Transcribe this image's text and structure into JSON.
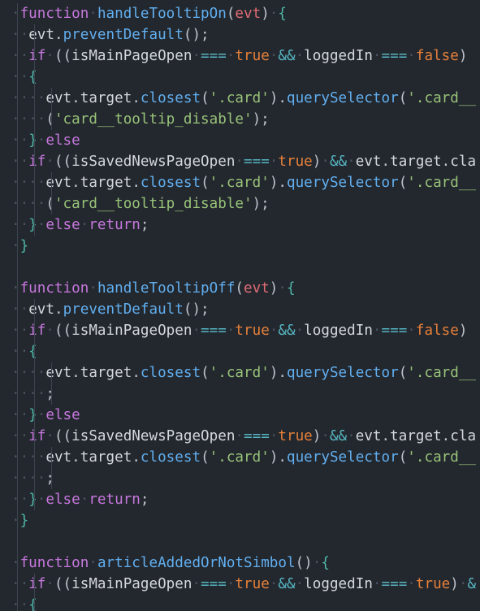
{
  "colors": {
    "background": "#23272e",
    "keyword": "#c678dd",
    "function_name": "#61afef",
    "identifier": "#d4d8dd",
    "operator": "#56b6c2",
    "boolean": "#e5803a",
    "string": "#98c379",
    "parameter": "#e06c75"
  },
  "lines": [
    [
      [
        "ws",
        "·"
      ],
      [
        "kw",
        "function"
      ],
      [
        "ws",
        "·"
      ],
      [
        "fn",
        "handleTooltipOn"
      ],
      [
        "pu",
        "("
      ],
      [
        "par",
        "evt"
      ],
      [
        "pu",
        ")"
      ],
      [
        "ws",
        "·"
      ],
      [
        "br",
        "{"
      ]
    ],
    [
      [
        "ws",
        "··"
      ],
      [
        "pl",
        "evt"
      ],
      [
        "pu",
        "."
      ],
      [
        "fn",
        "preventDefault"
      ],
      [
        "pu",
        "();"
      ]
    ],
    [
      [
        "ws",
        "··"
      ],
      [
        "kw",
        "if"
      ],
      [
        "ws",
        "·"
      ],
      [
        "pu",
        "(("
      ],
      [
        "pl",
        "isMainPageOpen"
      ],
      [
        "ws",
        "·"
      ],
      [
        "op",
        "==="
      ],
      [
        "ws",
        "·"
      ],
      [
        "bo",
        "true"
      ],
      [
        "ws",
        "·"
      ],
      [
        "op",
        "&&"
      ],
      [
        "ws",
        "·"
      ],
      [
        "pl",
        "loggedIn"
      ],
      [
        "ws",
        "·"
      ],
      [
        "op",
        "==="
      ],
      [
        "ws",
        "·"
      ],
      [
        "bo",
        "false"
      ],
      [
        "pu",
        ")"
      ]
    ],
    [
      [
        "ws",
        "··"
      ],
      [
        "br",
        "{"
      ]
    ],
    [
      [
        "ws",
        "····"
      ],
      [
        "pl",
        "evt"
      ],
      [
        "pu",
        "."
      ],
      [
        "pl",
        "target"
      ],
      [
        "pu",
        "."
      ],
      [
        "fn",
        "closest"
      ],
      [
        "pu",
        "("
      ],
      [
        "str",
        "'.card'"
      ],
      [
        "pu",
        ")."
      ],
      [
        "fn",
        "querySelector"
      ],
      [
        "pu",
        "("
      ],
      [
        "str",
        "'.card__"
      ]
    ],
    [
      [
        "ws",
        "····"
      ],
      [
        "pu",
        "("
      ],
      [
        "str",
        "'card__tooltip_disable'"
      ],
      [
        "pu",
        ");"
      ]
    ],
    [
      [
        "ws",
        "··"
      ],
      [
        "br",
        "}"
      ],
      [
        "ws",
        "·"
      ],
      [
        "kw",
        "else"
      ]
    ],
    [
      [
        "ws",
        "··"
      ],
      [
        "kw",
        "if"
      ],
      [
        "ws",
        "·"
      ],
      [
        "pu",
        "(("
      ],
      [
        "pl",
        "isSavedNewsPageOpen"
      ],
      [
        "ws",
        "·"
      ],
      [
        "op",
        "==="
      ],
      [
        "ws",
        "·"
      ],
      [
        "bo",
        "true"
      ],
      [
        "pu",
        ")"
      ],
      [
        "ws",
        "·"
      ],
      [
        "op",
        "&&"
      ],
      [
        "ws",
        "·"
      ],
      [
        "pl",
        "evt"
      ],
      [
        "pu",
        "."
      ],
      [
        "pl",
        "target"
      ],
      [
        "pu",
        "."
      ],
      [
        "pl",
        "cla"
      ]
    ],
    [
      [
        "ws",
        "····"
      ],
      [
        "pl",
        "evt"
      ],
      [
        "pu",
        "."
      ],
      [
        "pl",
        "target"
      ],
      [
        "pu",
        "."
      ],
      [
        "fn",
        "closest"
      ],
      [
        "pu",
        "("
      ],
      [
        "str",
        "'.card'"
      ],
      [
        "pu",
        ")."
      ],
      [
        "fn",
        "querySelector"
      ],
      [
        "pu",
        "("
      ],
      [
        "str",
        "'.card__"
      ]
    ],
    [
      [
        "ws",
        "····"
      ],
      [
        "pu",
        "("
      ],
      [
        "str",
        "'card__tooltip_disable'"
      ],
      [
        "pu",
        ");"
      ]
    ],
    [
      [
        "ws",
        "··"
      ],
      [
        "br",
        "}"
      ],
      [
        "ws",
        "·"
      ],
      [
        "kw",
        "else"
      ],
      [
        "ws",
        "·"
      ],
      [
        "kw",
        "return"
      ],
      [
        "pu",
        ";"
      ]
    ],
    [
      [
        "ws",
        "·"
      ],
      [
        "br",
        "}"
      ]
    ],
    [],
    [
      [
        "ws",
        "·"
      ],
      [
        "kw",
        "function"
      ],
      [
        "ws",
        "·"
      ],
      [
        "fn",
        "handleTooltipOff"
      ],
      [
        "pu",
        "("
      ],
      [
        "par",
        "evt"
      ],
      [
        "pu",
        ")"
      ],
      [
        "ws",
        "·"
      ],
      [
        "br",
        "{"
      ]
    ],
    [
      [
        "ws",
        "··"
      ],
      [
        "pl",
        "evt"
      ],
      [
        "pu",
        "."
      ],
      [
        "fn",
        "preventDefault"
      ],
      [
        "pu",
        "();"
      ]
    ],
    [
      [
        "ws",
        "··"
      ],
      [
        "kw",
        "if"
      ],
      [
        "ws",
        "·"
      ],
      [
        "pu",
        "(("
      ],
      [
        "pl",
        "isMainPageOpen"
      ],
      [
        "ws",
        "·"
      ],
      [
        "op",
        "==="
      ],
      [
        "ws",
        "·"
      ],
      [
        "bo",
        "true"
      ],
      [
        "ws",
        "·"
      ],
      [
        "op",
        "&&"
      ],
      [
        "ws",
        "·"
      ],
      [
        "pl",
        "loggedIn"
      ],
      [
        "ws",
        "·"
      ],
      [
        "op",
        "==="
      ],
      [
        "ws",
        "·"
      ],
      [
        "bo",
        "false"
      ],
      [
        "pu",
        ")"
      ]
    ],
    [
      [
        "ws",
        "··"
      ],
      [
        "br",
        "{"
      ]
    ],
    [
      [
        "ws",
        "····"
      ],
      [
        "pl",
        "evt"
      ],
      [
        "pu",
        "."
      ],
      [
        "pl",
        "target"
      ],
      [
        "pu",
        "."
      ],
      [
        "fn",
        "closest"
      ],
      [
        "pu",
        "("
      ],
      [
        "str",
        "'.card'"
      ],
      [
        "pu",
        ")."
      ],
      [
        "fn",
        "querySelector"
      ],
      [
        "pu",
        "("
      ],
      [
        "str",
        "'.card__"
      ]
    ],
    [
      [
        "ws",
        "····"
      ],
      [
        "pu",
        ";"
      ]
    ],
    [
      [
        "ws",
        "··"
      ],
      [
        "br",
        "}"
      ],
      [
        "ws",
        "·"
      ],
      [
        "kw",
        "else"
      ]
    ],
    [
      [
        "ws",
        "··"
      ],
      [
        "kw",
        "if"
      ],
      [
        "ws",
        "·"
      ],
      [
        "pu",
        "(("
      ],
      [
        "pl",
        "isSavedNewsPageOpen"
      ],
      [
        "ws",
        "·"
      ],
      [
        "op",
        "==="
      ],
      [
        "ws",
        "·"
      ],
      [
        "bo",
        "true"
      ],
      [
        "pu",
        ")"
      ],
      [
        "ws",
        "·"
      ],
      [
        "op",
        "&&"
      ],
      [
        "ws",
        "·"
      ],
      [
        "pl",
        "evt"
      ],
      [
        "pu",
        "."
      ],
      [
        "pl",
        "target"
      ],
      [
        "pu",
        "."
      ],
      [
        "pl",
        "cla"
      ]
    ],
    [
      [
        "ws",
        "····"
      ],
      [
        "pl",
        "evt"
      ],
      [
        "pu",
        "."
      ],
      [
        "pl",
        "target"
      ],
      [
        "pu",
        "."
      ],
      [
        "fn",
        "closest"
      ],
      [
        "pu",
        "("
      ],
      [
        "str",
        "'.card'"
      ],
      [
        "pu",
        ")."
      ],
      [
        "fn",
        "querySelector"
      ],
      [
        "pu",
        "("
      ],
      [
        "str",
        "'.card__"
      ]
    ],
    [
      [
        "ws",
        "····"
      ],
      [
        "pu",
        ";"
      ]
    ],
    [
      [
        "ws",
        "··"
      ],
      [
        "br",
        "}"
      ],
      [
        "ws",
        "·"
      ],
      [
        "kw",
        "else"
      ],
      [
        "ws",
        "·"
      ],
      [
        "kw",
        "return"
      ],
      [
        "pu",
        ";"
      ]
    ],
    [
      [
        "ws",
        "·"
      ],
      [
        "br",
        "}"
      ]
    ],
    [],
    [
      [
        "ws",
        "·"
      ],
      [
        "kw",
        "function"
      ],
      [
        "ws",
        "·"
      ],
      [
        "fn",
        "articleAddedOrNotSimbol"
      ],
      [
        "pu",
        "()"
      ],
      [
        "ws",
        "·"
      ],
      [
        "br",
        "{"
      ]
    ],
    [
      [
        "ws",
        "··"
      ],
      [
        "kw",
        "if"
      ],
      [
        "ws",
        "·"
      ],
      [
        "pu",
        "(("
      ],
      [
        "pl",
        "isMainPageOpen"
      ],
      [
        "ws",
        "·"
      ],
      [
        "op",
        "==="
      ],
      [
        "ws",
        "·"
      ],
      [
        "bo",
        "true"
      ],
      [
        "ws",
        "·"
      ],
      [
        "op",
        "&&"
      ],
      [
        "ws",
        "·"
      ],
      [
        "pl",
        "loggedIn"
      ],
      [
        "ws",
        "·"
      ],
      [
        "op",
        "==="
      ],
      [
        "ws",
        "·"
      ],
      [
        "bo",
        "true"
      ],
      [
        "pu",
        ")"
      ],
      [
        "ws",
        "·"
      ],
      [
        "op",
        "&"
      ]
    ],
    [
      [
        "ws",
        "··"
      ],
      [
        "br",
        "{"
      ]
    ]
  ]
}
